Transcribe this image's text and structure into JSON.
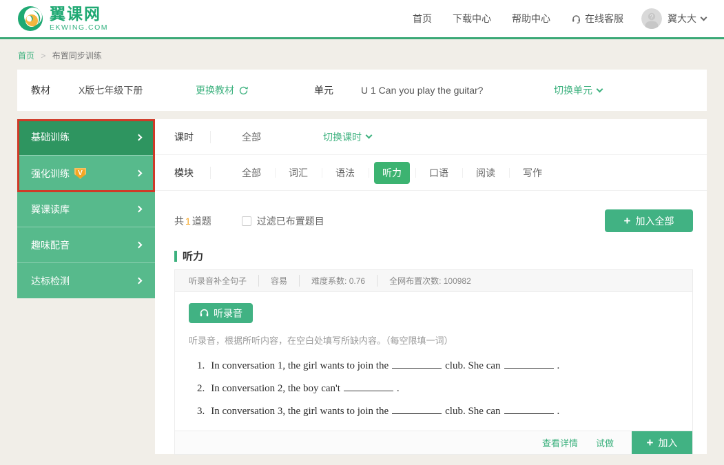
{
  "colors": {
    "accent": "#3cb17e",
    "sidebar": "#57ba8c",
    "sidebar_active": "#2e9560",
    "annotation_red": "#cf3a28",
    "orange": "#f5a623",
    "header_border": "#3aa876"
  },
  "header": {
    "logo_title": "翼课网",
    "logo_subtitle": "EKWING.COM",
    "nav": [
      "首页",
      "下载中心",
      "帮助中心",
      "在线客服"
    ],
    "user_name": "翼大大"
  },
  "breadcrumb": {
    "home": "首页",
    "sep": ">",
    "current": "布置同步训练"
  },
  "selection": {
    "textbook_label": "教材",
    "textbook_value": "X版七年级下册",
    "change_textbook": "更换教材",
    "unit_label": "单元",
    "unit_value": "U 1 Can you play the guitar?",
    "change_unit": "切换单元"
  },
  "sidebar": {
    "items": [
      {
        "label": "基础训练"
      },
      {
        "label": "强化训练",
        "vip": "V"
      },
      {
        "label": "翼课读库"
      },
      {
        "label": "趣味配音"
      },
      {
        "label": "达标检测"
      }
    ]
  },
  "filters": {
    "lesson_label": "课时",
    "lesson_value": "全部",
    "switch_lesson": "切换课时",
    "module_label": "模块",
    "modules": [
      "全部",
      "词汇",
      "语法",
      "听力",
      "口语",
      "阅读",
      "写作"
    ],
    "active_module": "听力"
  },
  "toolbar": {
    "count_prefix": "共",
    "count": "1",
    "count_suffix": "道题",
    "filter_label": "过滤已布置题目",
    "add_all_plus": "+",
    "add_all": "加入全部"
  },
  "section_title": "听力",
  "question": {
    "meta": [
      "听录音补全句子",
      "容易",
      "难度系数: 0.76",
      "全网布置次数: 100982"
    ],
    "listen_button": "听录音",
    "instruction": "听录音，根据所听内容，在空白处填写所缺内容。（每空限填一词）",
    "items": [
      {
        "num": "1.",
        "before": "In conversation 1, the girl wants to join the",
        "middle": "club. She can",
        "tail": "."
      },
      {
        "num": "2.",
        "before": "In conversation 2, the boy can't",
        "tail": "."
      },
      {
        "num": "3.",
        "before": "In conversation 3, the girl wants to join the",
        "middle": "club. She can",
        "tail": "."
      }
    ],
    "actions": {
      "detail": "查看详情",
      "try": "试做",
      "add_plus": "+",
      "add": "加入"
    }
  }
}
